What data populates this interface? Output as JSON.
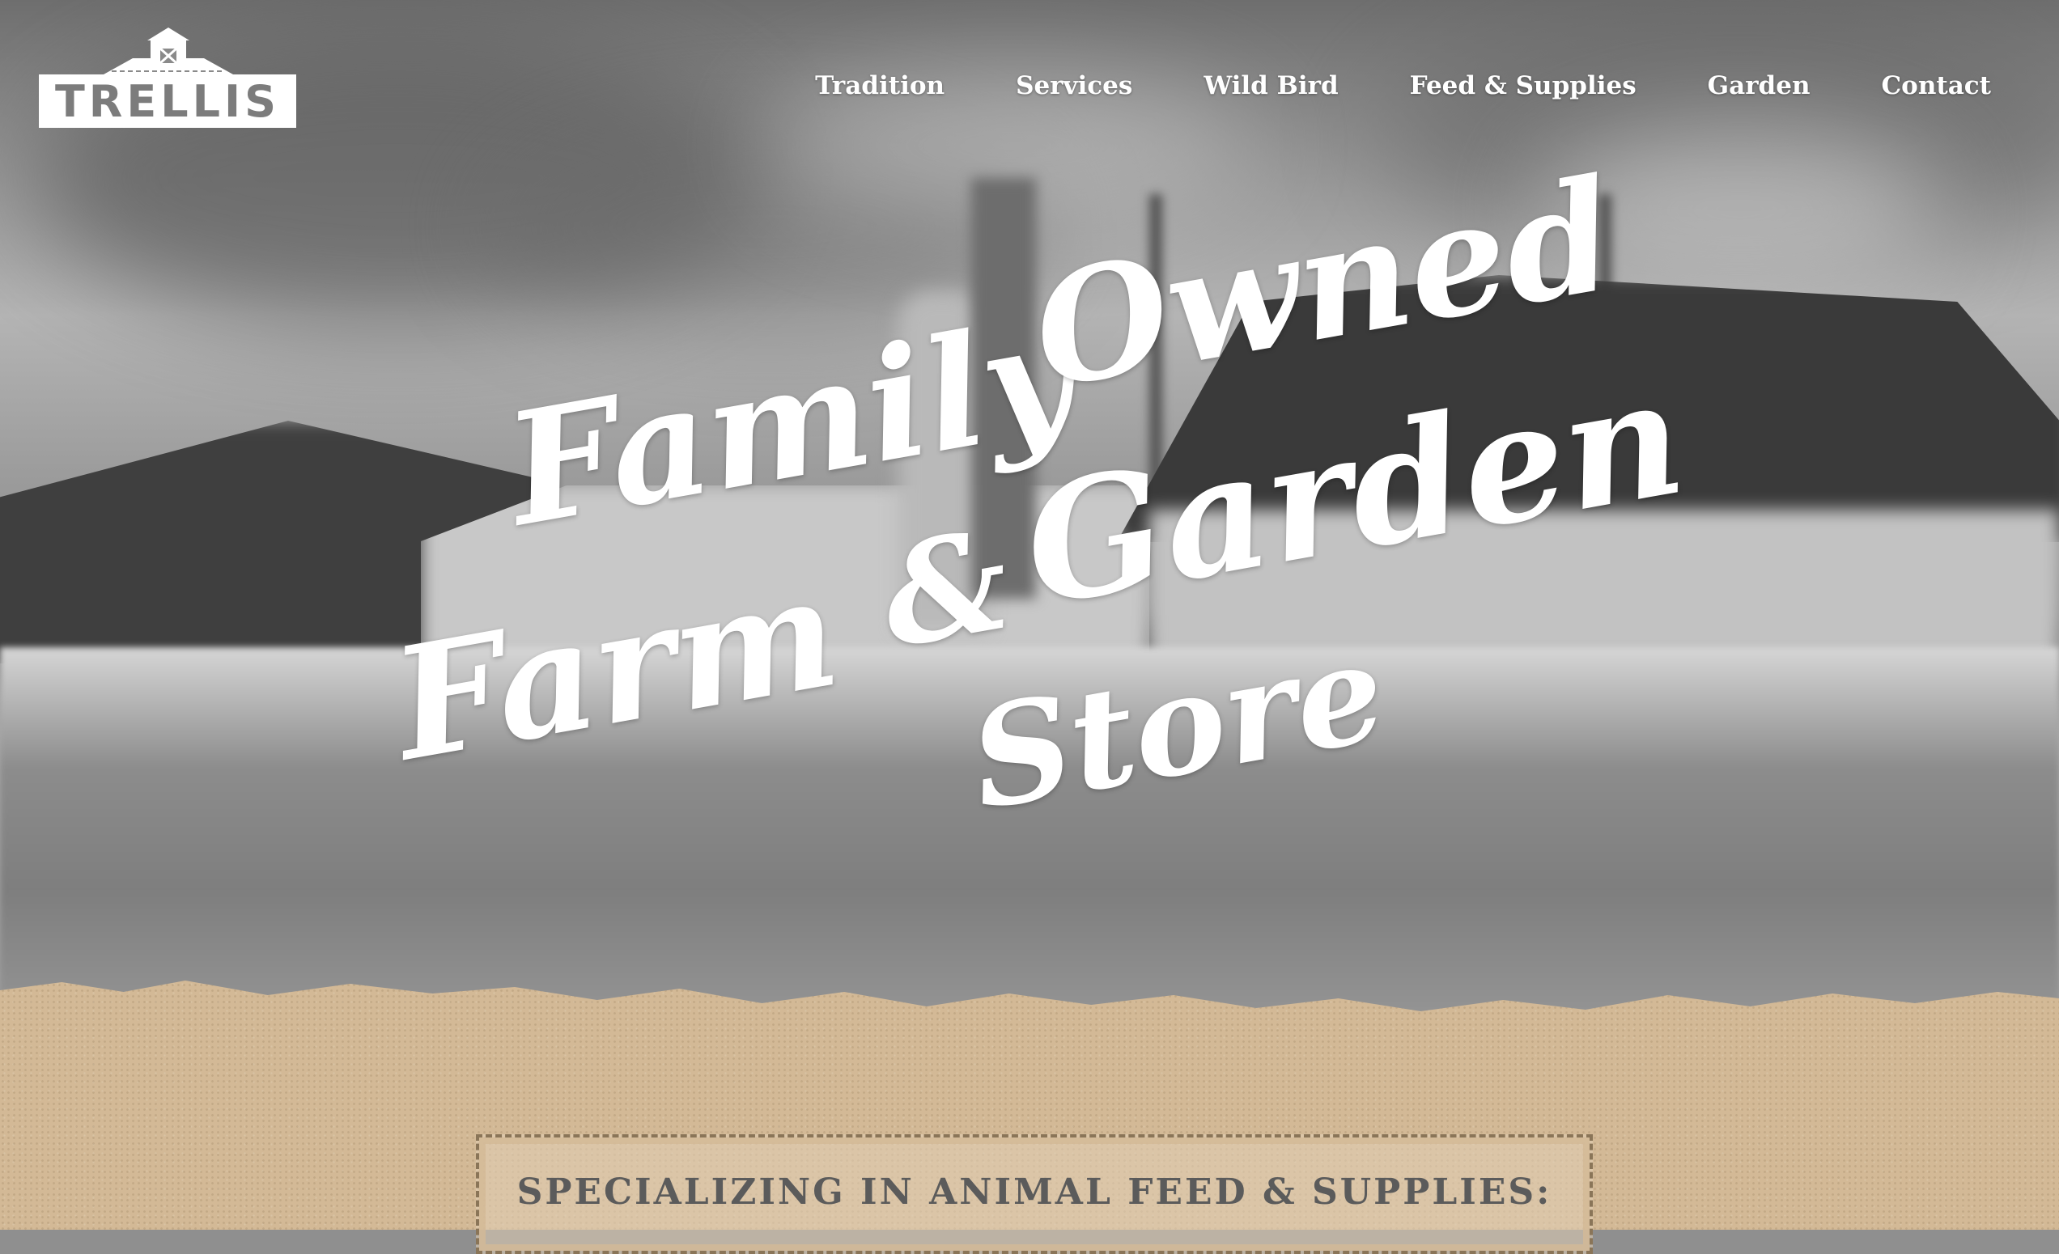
{
  "logo": {
    "text": "TRELLIS"
  },
  "nav": {
    "items": [
      {
        "label": "Tradition"
      },
      {
        "label": "Services"
      },
      {
        "label": "Wild Bird"
      },
      {
        "label": "Feed & Supplies"
      },
      {
        "label": "Garden"
      },
      {
        "label": "Contact"
      }
    ]
  },
  "hero": {
    "line_family": "Family",
    "line_owned": "Owned",
    "line_farm": "Farm",
    "line_amp": "&",
    "line_garden": "Garden",
    "line_store": "Store"
  },
  "section": {
    "heading": "SPECIALIZING IN ANIMAL FEED & SUPPLIES:"
  },
  "colors": {
    "paper": "#d3b996",
    "banner_text": "#5b5b5b",
    "nav_text": "#ffffff"
  },
  "icons": {
    "logo_mark": "barn-icon"
  }
}
